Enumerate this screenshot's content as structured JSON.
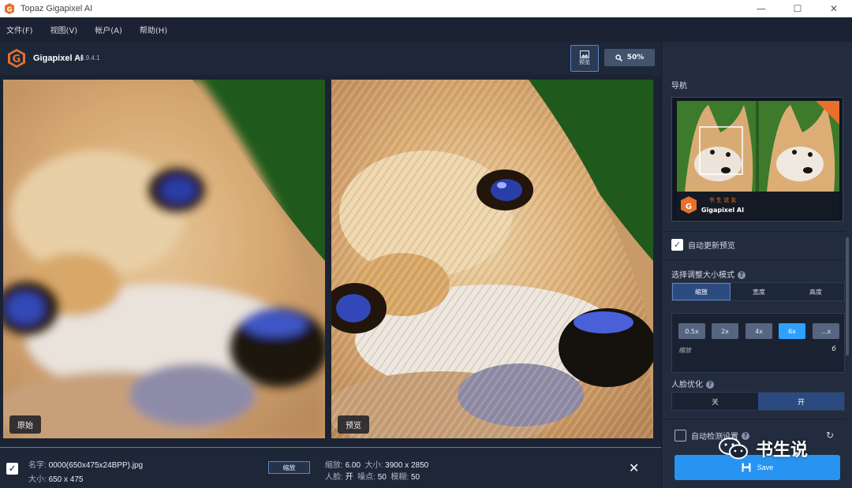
{
  "window": {
    "title": "Topaz Gigapixel AI",
    "minimize": "—",
    "maximize": "☐",
    "close": "✕"
  },
  "menu": [
    "文件(F)",
    "视图(V)",
    "帐户(A)",
    "帮助(H)"
  ],
  "header": {
    "brand": "Gigapixel AI",
    "version": "v4.9.4.1",
    "preview_label": "预览",
    "zoom_label": "50%"
  },
  "viewer": {
    "original_label": "原始",
    "preview_label": "预览"
  },
  "status": {
    "name_label": "名字:",
    "name_value": "0000(650x475x24BPP).jpg",
    "size_label": "大小:",
    "size_value": "650 x 475",
    "scale_button": "缩放",
    "scale_label": "缩放:",
    "scale_value": "6.00",
    "out_size_label": "大小:",
    "out_size_value": "3900 x 2850",
    "face_label": "人脸:",
    "face_value": "开",
    "noise_label": "噪点:",
    "noise_value": "50",
    "blur_label": "模糊:",
    "blur_value": "50",
    "close": "✕"
  },
  "sidebar": {
    "nav_title": "导航",
    "thumb_brand": "Gigapixel AI",
    "thumb_site": "书 生 说 友",
    "auto_update": "自动更新预览",
    "mode_title": "选择调整大小模式",
    "mode_tabs": [
      "缩放",
      "宽度",
      "高度"
    ],
    "scale_options": [
      "0.5x",
      "2x",
      "4x",
      "6x",
      "...x"
    ],
    "scale_label": "缩放",
    "scale_value": "6",
    "face_title": "人脸优化",
    "face_options": [
      "关",
      "开"
    ],
    "auto_detect": "自动检测设置",
    "save_label": "Save"
  },
  "watermark": "书生说",
  "colors": {
    "accent": "#2694f0",
    "active_scale": "#2ea1ff",
    "border_accent": "#5b86c8"
  }
}
